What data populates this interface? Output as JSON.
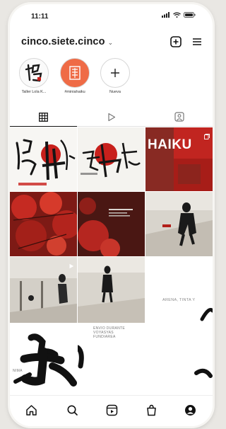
{
  "status_bar": {
    "time": "11:11"
  },
  "profile": {
    "username": "cinco.siete.cinco"
  },
  "highlights": [
    {
      "label": "Taller Lola K..."
    },
    {
      "label": "#miniahaiku"
    },
    {
      "label": "Nueva"
    }
  ],
  "grid": {
    "haiku_post_text": "HAIKU",
    "arena_caption": "ARENA, TINTA Y",
    "center_caption": [
      "ENVIO DURANTE",
      "VOYASYAS",
      "FUNDIAREA"
    ],
    "left_caption": "NIMA"
  },
  "colors": {
    "accent_red": "#c8201c",
    "dark": "#111111"
  },
  "icons": {
    "header": [
      "add-post-icon",
      "menu-icon"
    ],
    "tabs": [
      "grid-icon",
      "reels-icon",
      "tagged-icon"
    ],
    "nav": [
      "home-icon",
      "search-icon",
      "reels-icon",
      "shop-icon",
      "profile-icon"
    ]
  }
}
